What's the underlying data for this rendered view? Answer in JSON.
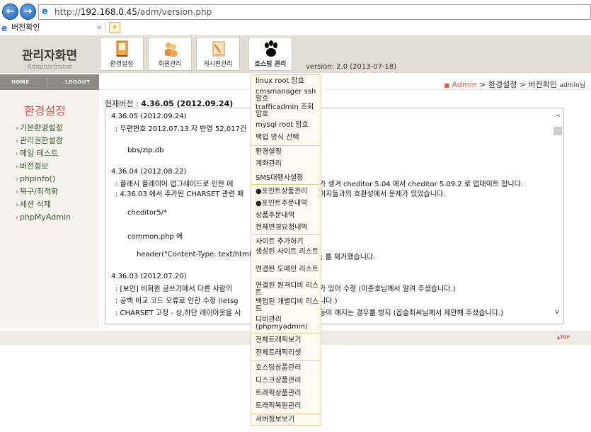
{
  "browser": {
    "url_prefix": "http://",
    "url_host": "192.168.0.45",
    "url_path": "/adm/version.php",
    "tab_title": "버전확인",
    "tab_close": "×"
  },
  "brand": {
    "title": "관리자화면",
    "subtitle": "Administrator"
  },
  "topmenu": [
    {
      "label": "환경설정",
      "icon": "settings-book-icon"
    },
    {
      "label": "회원관리",
      "icon": "members-icon"
    },
    {
      "label": "게시판관리",
      "icon": "board-icon"
    },
    {
      "label": "호스팅 관리",
      "icon": "paw-icon"
    }
  ],
  "version_text": "version: 2.0 (2013-07-18)",
  "leftbar": {
    "home": "HOME",
    "logout": "LOGOUT"
  },
  "breadcrumb": {
    "admin": "Admin",
    "sep": ">",
    "section": "환경설정",
    "page": "버전확인",
    "user": "admin님"
  },
  "sidebar": {
    "title": "환경설정",
    "items": [
      "기본환경설정",
      "관리권한설정",
      "메일 테스트",
      "버전정보",
      "phpinfo()",
      "복구/최적화",
      "세션 삭제",
      "phpMyAdmin"
    ]
  },
  "current_version": {
    "label": "현재버전 :",
    "value": "4.36.05 (2012.09.24)"
  },
  "changelog": [
    "4.36.05 (2012.09.24)",
    "  :  우편번호 2012.07.13.자 반영 52,017건",
    "bbs/zip.db",
    "4.36.04 (2012.08.22)",
    "  :  플래시 플레이어 업그레이드로 인한 에",
    "가 생겨 cheditor 5.04 에서 cheditor 5.09.2 로 업데이트 합니다.",
    "  :  4.36.03 에서 추가된 CHARSET 관련 패",
    "이지들과의 호환성에서 문제가 있었습니다.",
    "cheditor5/*",
    "common.php 에",
    "header(\"Content-Type: text/html; ch",
    "; 를 제거했습니다.",
    "4.36.03 (2012.07.20)",
    "  :  [보안] 비회원 글쓰기에서 다른 사람의",
    "가 있어 수정 (이준호님께서 알려 주셨습니다.)",
    "  :  공백 비교 코드 오류로 인한 수정 (letsg",
    "니다.)",
    "  :  CHARSET 고정 - 상,하단 레이아웃을 사",
    "등이 깨지는 경우를 방지 (꼽슬최씨님께서 제안해 주셨습니다.)"
  ],
  "dropdown": [
    "linux root 암호",
    "cmsmanager ssh 암호",
    "trafficadmin 조회 암호",
    "mysql root 암호",
    "백업 방식 선택",
    "환경설정",
    "계좌관리",
    "SMS대행사설정",
    "●포인트상품관리",
    "●포인트주문내역",
    "상품주문내역",
    "전체변경요청내역",
    "사이트 추가하기",
    "생성된 사이트 리스트",
    "연결된 도메인 리스트",
    "연결된 원격디비 리스트",
    "백업된 개별디비 리스트",
    "디비관리 (phpmyadmin)",
    "전체트래픽보기",
    "전체트래픽리셋",
    "호스팅상품관리",
    "디스크상품관리",
    "트래픽상품관리",
    "트래픽복원관리",
    "서버정보보기"
  ],
  "top_link": "▲TOP",
  "colors": {
    "accent_red": "#d8584d",
    "header_bg": "#e2ddd4",
    "dropdown_border": "#e9cd8a"
  }
}
